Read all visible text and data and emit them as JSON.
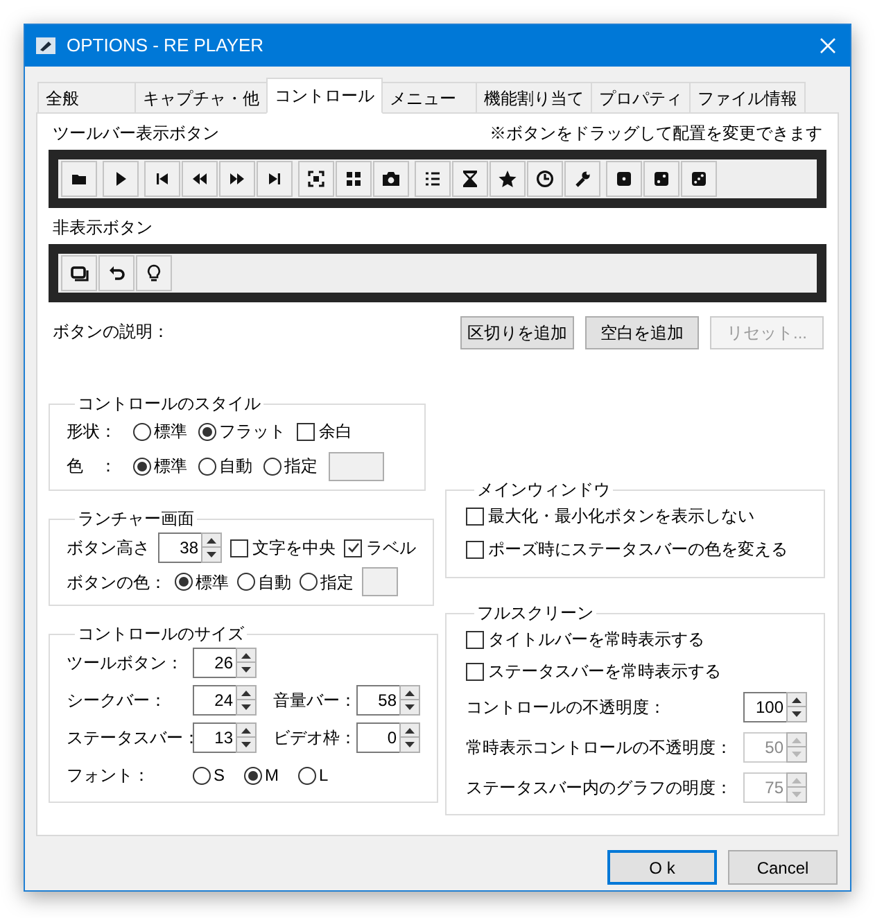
{
  "window": {
    "title": "OPTIONS - RE PLAYER"
  },
  "tabs": [
    {
      "label": "全般",
      "selected": false
    },
    {
      "label": "キャプチャ・他",
      "selected": false
    },
    {
      "label": "コントロール",
      "selected": true
    },
    {
      "label": "メニュー",
      "selected": false
    },
    {
      "label": "機能割り当て",
      "selected": false
    },
    {
      "label": "プロパティ",
      "selected": false
    },
    {
      "label": "ファイル情報",
      "selected": false
    }
  ],
  "toolbar_label": "ツールバー表示ボタン",
  "toolbar_hint": "※ボタンをドラッグして配置を変更できます",
  "hidden_label": "非表示ボタン",
  "description_label": "ボタンの説明：",
  "action_buttons": [
    {
      "label": "区切りを追加",
      "disabled": false
    },
    {
      "label": "空白を追加",
      "disabled": false
    },
    {
      "label": "リセット...",
      "disabled": true
    }
  ],
  "control_style": {
    "title": "コントロールのスタイル",
    "shape_label": "形状：",
    "shape_options": [
      {
        "label": "標準",
        "selected": false
      },
      {
        "label": "フラット",
        "selected": true
      }
    ],
    "margin_checkbox": {
      "label": "余白",
      "checked": false
    },
    "color_label": "色　：",
    "color_options": [
      {
        "label": "標準",
        "selected": true
      },
      {
        "label": "自動",
        "selected": false
      },
      {
        "label": "指定",
        "selected": false
      }
    ]
  },
  "launcher": {
    "title": "ランチャー画面",
    "height_label": "ボタン高さ",
    "height_value": "38",
    "checkboxes": [
      {
        "label": "文字を中央",
        "checked": false
      },
      {
        "label": "ラベル",
        "checked": true
      }
    ],
    "color_label": "ボタンの色：",
    "color_options": [
      {
        "label": "標準",
        "selected": true
      },
      {
        "label": "自動",
        "selected": false
      },
      {
        "label": "指定",
        "selected": false
      }
    ]
  },
  "control_size": {
    "title": "コントロールのサイズ",
    "rows": [
      [
        {
          "label": "ツールボタン：",
          "value": "26"
        }
      ],
      [
        {
          "label": "シークバー：",
          "value": "24"
        },
        {
          "label": "音量バー：",
          "value": "58"
        }
      ],
      [
        {
          "label": "ステータスバー：",
          "value": "13"
        },
        {
          "label": "ビデオ枠：",
          "value": "0"
        }
      ]
    ],
    "font_label": "フォント：",
    "font_options": [
      {
        "label": "S",
        "selected": false
      },
      {
        "label": "M",
        "selected": true
      },
      {
        "label": "L",
        "selected": false
      }
    ]
  },
  "main_window": {
    "title": "メインウィンドウ",
    "checkboxes": [
      {
        "label": "最大化・最小化ボタンを表示しない",
        "checked": false
      },
      {
        "label": "ポーズ時にステータスバーの色を変える",
        "checked": false
      }
    ]
  },
  "fullscreen": {
    "title": "フルスクリーン",
    "checkboxes": [
      {
        "label": "タイトルバーを常時表示する",
        "checked": false
      },
      {
        "label": "ステータスバーを常時表示する",
        "checked": false
      }
    ],
    "spinners": [
      {
        "label": "コントロールの不透明度：",
        "value": "100",
        "disabled": false
      },
      {
        "label": "常時表示コントロールの不透明度：",
        "value": "50",
        "disabled": true
      },
      {
        "label": "ステータスバー内のグラフの明度：",
        "value": "75",
        "disabled": true
      }
    ]
  },
  "footer_buttons": [
    {
      "label": "O k",
      "default": true
    },
    {
      "label": "Cancel",
      "default": false
    }
  ]
}
